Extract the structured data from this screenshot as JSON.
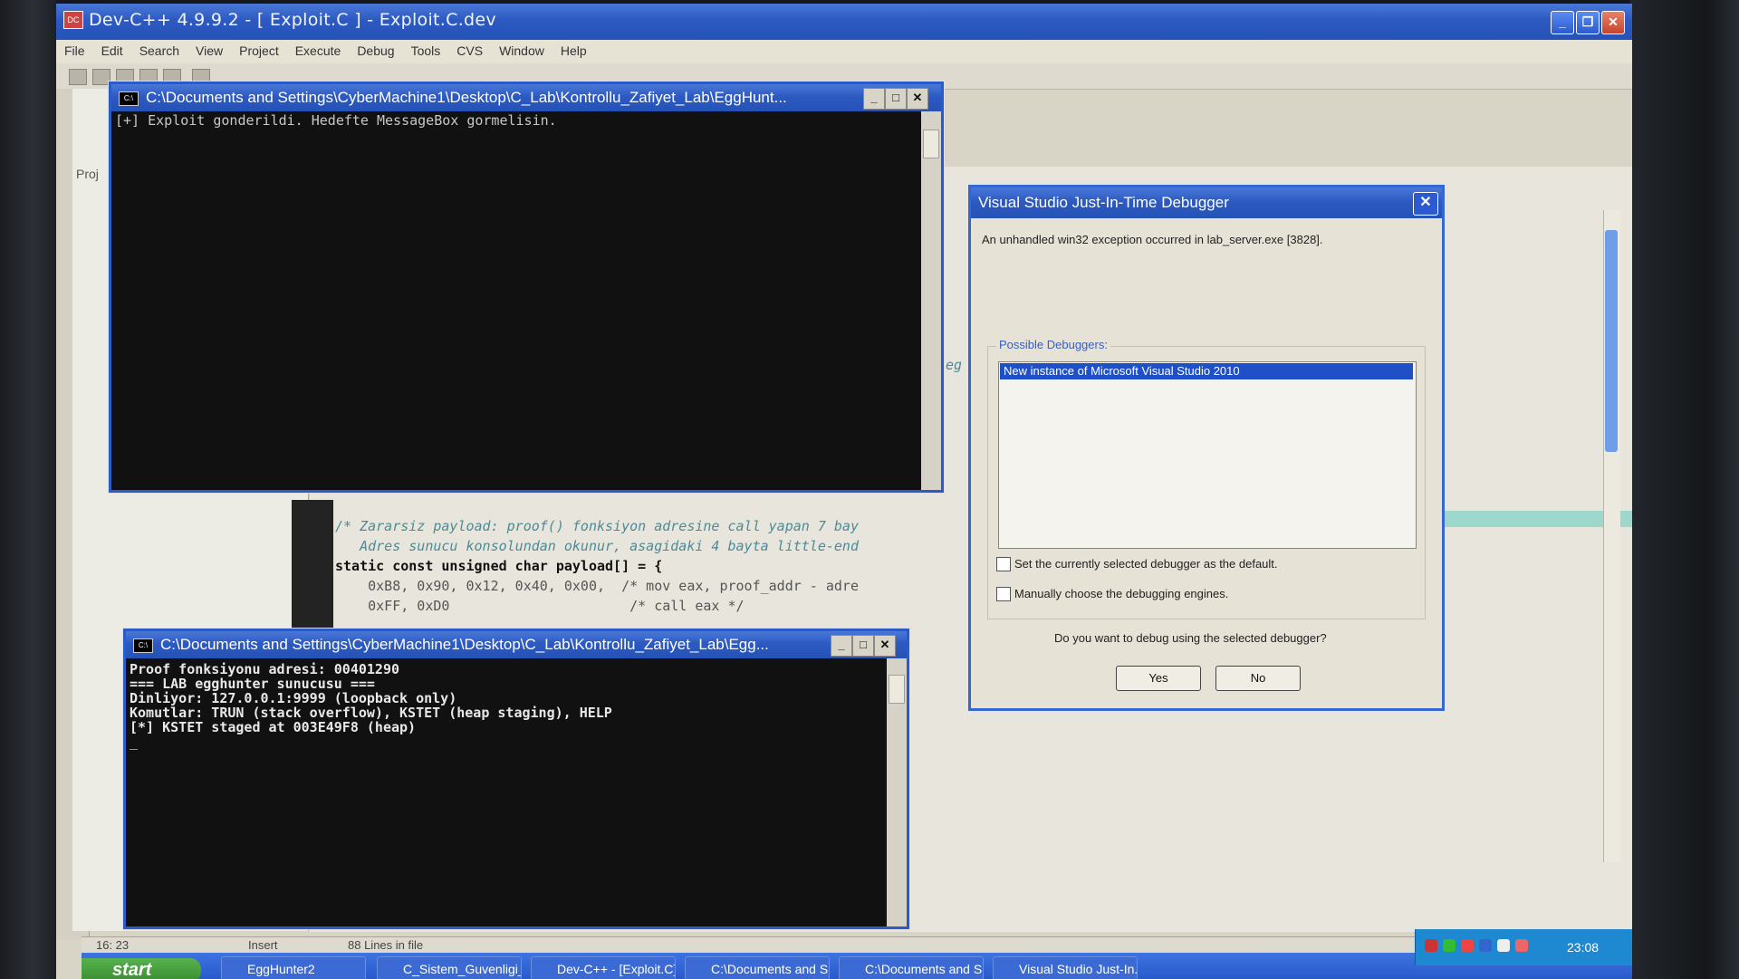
{
  "devcpp": {
    "title": "Dev-C++ 4.9.9.2 - [ Exploit.C ] - Exploit.C.dev",
    "menu": [
      "File",
      "Edit",
      "Search",
      "View",
      "Project",
      "Execute",
      "Debug",
      "Tools",
      "CVS",
      "Window",
      "Help"
    ],
    "project_tab": "Proj",
    "code": [
      "/* Zararsiz payload: proof() fonksiyon adresine call yapan 7 bay",
      "   Adres sunucu konsolundan okunur, asagidaki 4 bayta little-end",
      "static const unsigned char payload[] = {",
      "    0xB8, 0x90, 0x12, 0x40, 0x00,  /* mov eax, proof_addr - adre",
      "    0xFF, 0xD0                      /* call eax */"
    ],
    "side_fragment": "eg",
    "status": {
      "position": "16: 23",
      "mode": "Insert",
      "lines": "88 Lines in file"
    }
  },
  "console_top": {
    "title": "C:\\Documents and Settings\\CyberMachine1\\Desktop\\C_Lab\\Kontrollu_Zafiyet_Lab\\EggHunt...",
    "lines": [
      "[+] Exploit gonderildi. Hedefte MessageBox gormelisin."
    ]
  },
  "console_bottom": {
    "title": "C:\\Documents and Settings\\CyberMachine1\\Desktop\\C_Lab\\Kontrollu_Zafiyet_Lab\\Egg...",
    "lines": [
      "Proof fonksiyonu adresi: 00401290",
      "=== LAB egghunter sunucusu ===",
      "Dinliyor: 127.0.0.1:9999 (loopback only)",
      "Komutlar: TRUN (stack overflow), KSTET (heap staging), HELP",
      "[*] KSTET staged at 003E49F8 (heap)",
      "_"
    ]
  },
  "jit_dialog": {
    "title": "Visual Studio Just-In-Time Debugger",
    "message": "An unhandled win32 exception occurred in lab_server.exe [3828].",
    "group_label": "Possible Debuggers:",
    "debuggers": [
      "New instance of Microsoft Visual Studio 2010"
    ],
    "checkbox_default": "Set the currently selected debugger as the default.",
    "checkbox_manual": "Manually choose the debugging engines.",
    "question": "Do you want to debug using the selected debugger?",
    "yes": "Yes",
    "no": "No"
  },
  "taskbar": {
    "start": "start",
    "tasks": [
      "EggHunter2",
      "C_Sistem_Guvenligi_...",
      "Dev-C++ - [Exploit.C]",
      "C:\\Documents and S...",
      "C:\\Documents and S...",
      "Visual Studio Just-In..."
    ],
    "clock": "23:08"
  },
  "colors": {
    "title_blue": "#2c5ac2",
    "console_bg": "#0c0c0c",
    "selection": "#2050c8",
    "comment": "#4e8a96"
  }
}
